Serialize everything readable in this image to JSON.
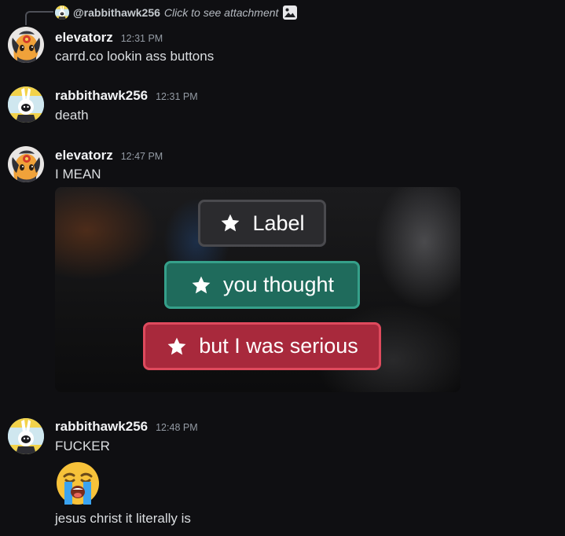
{
  "reply": {
    "username": "@rabbithawk256",
    "hint": "Click to see attachment",
    "icon": "image-icon"
  },
  "messages": [
    {
      "username": "elevatorz",
      "timestamp": "12:31 PM",
      "avatar": "elevatorz-avatar",
      "lines": [
        "carrd.co lookin ass buttons"
      ]
    },
    {
      "username": "rabbithawk256",
      "timestamp": "12:31 PM",
      "avatar": "rabbithawk256-avatar",
      "lines": [
        "death"
      ]
    },
    {
      "username": "elevatorz",
      "timestamp": "12:47 PM",
      "avatar": "elevatorz-avatar",
      "lines": [
        "I MEAN"
      ],
      "attachment": {
        "buttons": [
          {
            "label": "Label",
            "icon": "star-icon",
            "color": "#2b2b2e"
          },
          {
            "label": "you thought",
            "icon": "star-icon",
            "color": "#1f6b5c"
          },
          {
            "label": "but I was serious",
            "icon": "star-icon",
            "color": "#a8293c"
          }
        ]
      }
    },
    {
      "username": "rabbithawk256",
      "timestamp": "12:48 PM",
      "avatar": "rabbithawk256-avatar",
      "lines": [
        "FUCKER",
        "jesus christ it literally is"
      ],
      "emoji": "loudly-crying-face-emoji"
    }
  ],
  "colors": {
    "background": "#0f0f12",
    "username": "#f2f3f5",
    "timestamp": "#949ba4",
    "text": "#dbdee1"
  }
}
